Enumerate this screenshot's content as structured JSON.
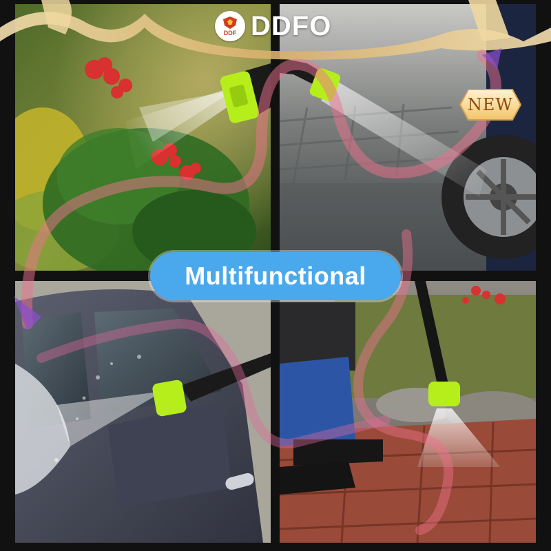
{
  "brand": {
    "badge_text": "DDF",
    "wordmark": "DDFO"
  },
  "headline": {
    "text": "Multifunctional"
  },
  "new_badge": {
    "text": "NEW"
  },
  "colors": {
    "headline_pill": "#4aa9ec",
    "nozzle_green": "#b6ee1c",
    "ribbon_pink": "#f0728f",
    "ribbon_gold": "#e9c98a",
    "brand_red": "#d23c1e"
  },
  "photos": [
    {
      "scene": "garden-watering",
      "icon": "spray-nozzle-icon"
    },
    {
      "scene": "driveway-cleaning",
      "icon": "spray-nozzle-icon"
    },
    {
      "scene": "car-washing",
      "icon": "spray-nozzle-icon"
    },
    {
      "scene": "patio-cleaning",
      "icon": "spray-nozzle-icon"
    }
  ]
}
